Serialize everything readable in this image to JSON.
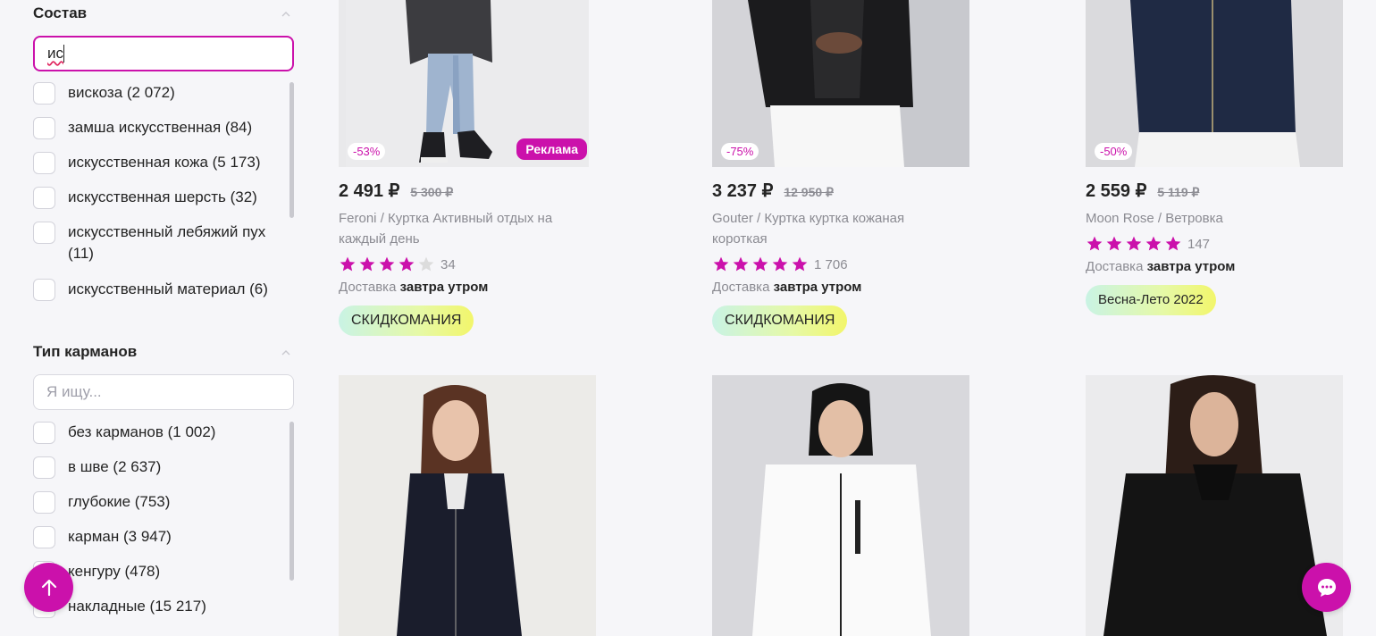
{
  "filters": {
    "composition": {
      "title": "Состав",
      "search_value": "ис",
      "options": [
        "вискоза (2 072)",
        "замша искусственная (84)",
        "искусственная кожа (5 173)",
        "искусственная шерсть (32)",
        "искусственный лебяжий пух (11)",
        "искусственный материал (6)"
      ]
    },
    "pockets": {
      "title": "Тип карманов",
      "search_placeholder": "Я ищу...",
      "options": [
        "без карманов (1 002)",
        "в шве (2 637)",
        "глубокие (753)",
        "карман (3 947)",
        "кенгуру (478)",
        "накладные (15 217)"
      ]
    }
  },
  "products": [
    {
      "discount": "-53%",
      "ad_label": "Реклама",
      "price": "2 491 ₽",
      "old_price": "5 300 ₽",
      "brand": "Feroni",
      "title": "Куртка Активный отдых на каждый день",
      "rating": 4,
      "reviews": "34",
      "delivery_label": "Доставка",
      "delivery_time": "завтра утром",
      "promo": "СКИДКОМАНИЯ"
    },
    {
      "discount": "-75%",
      "price": "3 237 ₽",
      "old_price": "12 950 ₽",
      "brand": "Gouter",
      "title": "Куртка куртка кожаная короткая",
      "rating": 5,
      "reviews": "1 706",
      "delivery_label": "Доставка",
      "delivery_time": "завтра утром",
      "promo": "СКИДКОМАНИЯ"
    },
    {
      "discount": "-50%",
      "price": "2 559 ₽",
      "old_price": "5 119 ₽",
      "brand": "Moon Rose",
      "title": "Ветровка",
      "rating": 5,
      "reviews": "147",
      "delivery_label": "Доставка",
      "delivery_time": "завтра утром",
      "promo": "Весна-Лето 2022"
    }
  ],
  "colors": {
    "accent": "#cb11ab",
    "star_empty": "#d9d9d9"
  }
}
